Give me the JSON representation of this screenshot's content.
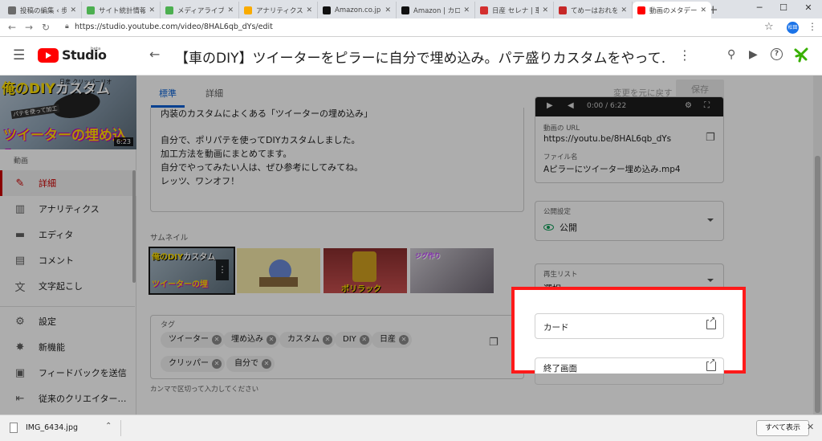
{
  "browser": {
    "tabs": [
      {
        "label": "投稿の編集 ‹ 歩",
        "color": "#6b6b6b",
        "active": false
      },
      {
        "label": "サイト統計情報",
        "color": "#4caf50",
        "active": false
      },
      {
        "label": "メディアライブラリ",
        "color": "#4caf50",
        "active": false
      },
      {
        "label": "アナリティクス",
        "color": "#f9ab00",
        "active": false
      },
      {
        "label": "Amazon.co.jp",
        "color": "#111111",
        "active": false
      },
      {
        "label": "Amazon | カロッ",
        "color": "#111111",
        "active": false
      },
      {
        "label": "日産 セレナ | 車",
        "color": "#d32f2f",
        "active": false
      },
      {
        "label": "てめーはおれを怒",
        "color": "#c62828",
        "active": false
      },
      {
        "label": "動画のメタデータ",
        "color": "#ff0000",
        "active": true
      }
    ],
    "url": "https://studio.youtube.com/video/8HAL6qb_dYs/edit",
    "profile_initial": "松田"
  },
  "studio": {
    "brand": "Studio",
    "beta": "beta",
    "video_title": "【車のDIY】ツイーターをピラーに自分で埋め込み。パテ盛りカスタムをやって…"
  },
  "sidebar": {
    "thumb_title_a": "俺の",
    "thumb_title_b": "DIY",
    "thumb_title_c": "カスタム",
    "thumb_subtitle": "日産 クリッパーリオ",
    "thumb_caption": "パテを使って加工",
    "thumb_bottom": "ツイーターの埋め込み",
    "thumb_duration": "6:23",
    "section_label": "動画",
    "items": [
      {
        "label": "詳細",
        "icon": "pencil-icon",
        "glyph": "✎",
        "active": true
      },
      {
        "label": "アナリティクス",
        "icon": "analytics-icon",
        "glyph": "▥",
        "active": false
      },
      {
        "label": "エディタ",
        "icon": "clapperboard-icon",
        "glyph": "▬",
        "active": false
      },
      {
        "label": "コメント",
        "icon": "comment-icon",
        "glyph": "▤",
        "active": false
      },
      {
        "label": "文字起こし",
        "icon": "translate-icon",
        "glyph": "文",
        "active": false
      }
    ],
    "bottom_items": [
      {
        "label": "設定",
        "icon": "gear-icon",
        "glyph": "⚙"
      },
      {
        "label": "新機能",
        "icon": "new-features-icon",
        "glyph": "✸"
      },
      {
        "label": "フィードバックを送信",
        "icon": "feedback-icon",
        "glyph": "▣"
      },
      {
        "label": "従来のクリエイター…",
        "icon": "classic-studio-icon",
        "glyph": "⇤"
      }
    ]
  },
  "main": {
    "tab_standard": "標準",
    "tab_details": "詳細",
    "revert_label": "変更を元に戻す",
    "save_label": "保存",
    "description_lines": [
      "内装のカスタムによくある「ツイーターの埋め込み」",
      "",
      "自分で、ポリパテを使ってDIYカスタムしました。",
      "加工方法を動画にまとめてます。",
      "自分でやってみたい人は、ぜひ参考にしてみてね。",
      "レッツ、ワンオフ！"
    ],
    "thumbnail_label": "サムネイル",
    "thumb1_a": "俺の",
    "thumb1_b": "DIY",
    "thumb1_c": "カスタム",
    "thumb1_bottom": "ツイーターの埋",
    "thumb3_text": "ポリラック",
    "thumb4_text": "ジグ作り",
    "tags_label": "タグ",
    "tags": [
      "ツイーター",
      "埋め込み",
      "カスタム",
      "DIY",
      "日産",
      "クリッパー",
      "自分で"
    ],
    "tags_help": "カンマで区切って入力してください"
  },
  "right": {
    "player_time": "0:00 / 6:22",
    "url_label": "動画の URL",
    "url_value": "https://youtu.be/8HAL6qb_dYs",
    "filename_label": "ファイル名",
    "filename_value": "Aピラーにツイーター埋め込み.mp4",
    "visibility_label": "公開設定",
    "visibility_value": "公開",
    "playlist_label": "再生リスト",
    "playlist_value": "選択",
    "cards_label": "カード",
    "endscreen_label": "終了画面"
  },
  "download": {
    "filename": "IMG_6434.jpg",
    "show_all": "すべて表示"
  },
  "colors": {
    "accent": "#065fd4",
    "youtube_red": "#ff0000",
    "highlight": "#ff1a1a",
    "visibility_green": "#0f9d58"
  }
}
